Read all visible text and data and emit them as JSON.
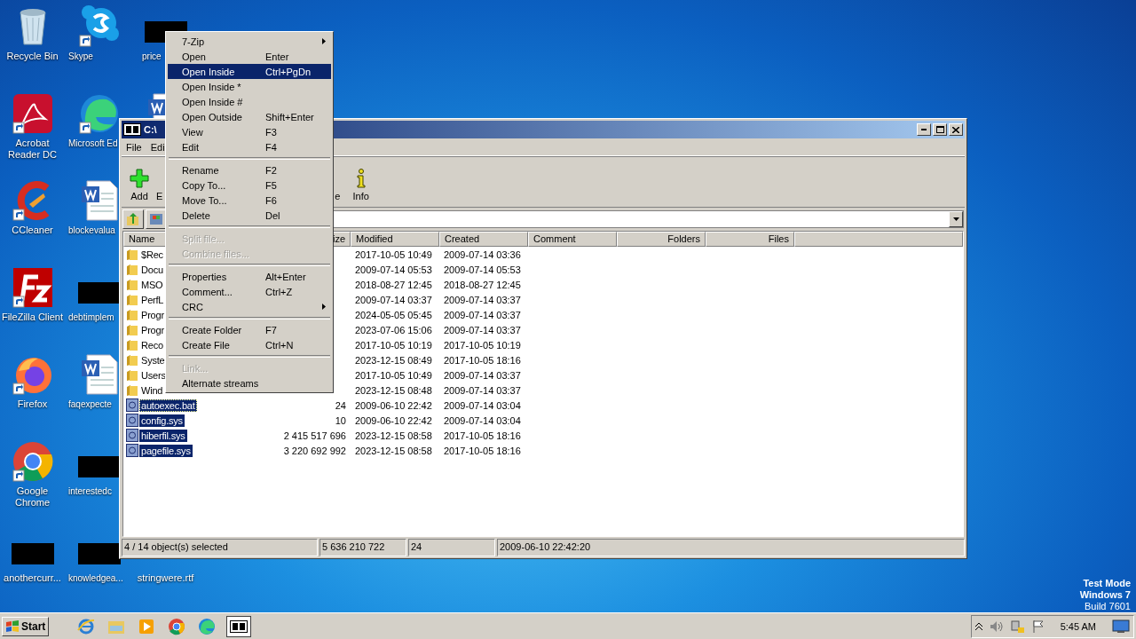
{
  "desktop": {
    "columns": [
      [
        {
          "label": "Recycle Bin",
          "kind": "recycle"
        },
        {
          "label": "Acrobat Reader DC",
          "kind": "acrobat"
        },
        {
          "label": "CCleaner",
          "kind": "ccleaner"
        },
        {
          "label": "FileZilla Client",
          "kind": "filezilla"
        },
        {
          "label": "Firefox",
          "kind": "firefox"
        },
        {
          "label": "Google Chrome",
          "kind": "chrome"
        },
        {
          "label": "anothercurr...",
          "kind": "redacted"
        }
      ],
      [
        {
          "label": "Skype",
          "kind": "skype"
        },
        {
          "label": "Microsoft Ed",
          "kind": "edge"
        },
        {
          "label": "blockevalua",
          "kind": "word"
        },
        {
          "label": "debtimplem",
          "kind": "redacted"
        },
        {
          "label": "faqexpecte",
          "kind": "word"
        },
        {
          "label": "interestedc",
          "kind": "redacted"
        },
        {
          "label": "knowledgea...",
          "kind": "redacted"
        }
      ],
      [
        {
          "label": "price",
          "kind": "redacted"
        },
        {
          "kind": "word"
        },
        {
          "label": "stringwere.rtf",
          "kind": "hidden"
        }
      ]
    ],
    "system_text": [
      "Test Mode",
      "Windows 7",
      "Build 7601"
    ]
  },
  "window": {
    "title": "C:\\",
    "menu": [
      "File",
      "Edi"
    ],
    "toolbar": [
      {
        "label": "Add",
        "kind": "add"
      },
      {
        "label": "E",
        "kind": "plain"
      },
      {
        "label": "e",
        "kind": "plain"
      },
      {
        "label": "Info",
        "kind": "info"
      }
    ],
    "columns": [
      "Name",
      "ize",
      "Modified",
      "Created",
      "Comment",
      "Folders",
      "Files"
    ],
    "rows": [
      {
        "name": "$Rec",
        "size": "",
        "modified": "2017-10-05 10:49",
        "created": "2009-07-14 03:36",
        "kind": "folder",
        "selected": false,
        "focused": false
      },
      {
        "name": "Docu",
        "size": "",
        "modified": "2009-07-14 05:53",
        "created": "2009-07-14 05:53",
        "kind": "folder",
        "selected": false,
        "focused": false
      },
      {
        "name": "MSO",
        "size": "",
        "modified": "2018-08-27 12:45",
        "created": "2018-08-27 12:45",
        "kind": "folder",
        "selected": false,
        "focused": false
      },
      {
        "name": "PerfL",
        "size": "",
        "modified": "2009-07-14 03:37",
        "created": "2009-07-14 03:37",
        "kind": "folder",
        "selected": false,
        "focused": false
      },
      {
        "name": "Progr",
        "size": "",
        "modified": "2024-05-05 05:45",
        "created": "2009-07-14 03:37",
        "kind": "folder",
        "selected": false,
        "focused": false
      },
      {
        "name": "Progr",
        "size": "",
        "modified": "2023-07-06 15:06",
        "created": "2009-07-14 03:37",
        "kind": "folder",
        "selected": false,
        "focused": false
      },
      {
        "name": "Reco",
        "size": "",
        "modified": "2017-10-05 10:19",
        "created": "2017-10-05 10:19",
        "kind": "folder",
        "selected": false,
        "focused": false
      },
      {
        "name": "Syste",
        "size": "",
        "modified": "2023-12-15 08:49",
        "created": "2017-10-05 18:16",
        "kind": "folder",
        "selected": false,
        "focused": false
      },
      {
        "name": "Users",
        "size": "",
        "modified": "2017-10-05 10:49",
        "created": "2009-07-14 03:37",
        "kind": "folder",
        "selected": false,
        "focused": false
      },
      {
        "name": "Wind",
        "size": "",
        "modified": "2023-12-15 08:48",
        "created": "2009-07-14 03:37",
        "kind": "folder",
        "selected": false,
        "focused": false
      },
      {
        "name": "autoexec.bat",
        "size": "24",
        "modified": "2009-06-10 22:42",
        "created": "2009-07-14 03:04",
        "kind": "file",
        "selected": true,
        "focused": true
      },
      {
        "name": "config.sys",
        "size": "10",
        "modified": "2009-06-10 22:42",
        "created": "2009-07-14 03:04",
        "kind": "file",
        "selected": true,
        "focused": false
      },
      {
        "name": "hiberfil.sys",
        "size": "2 415 517 696",
        "modified": "2023-12-15 08:58",
        "created": "2017-10-05 18:16",
        "kind": "file",
        "selected": true,
        "focused": false
      },
      {
        "name": "pagefile.sys",
        "size": "3 220 692 992",
        "modified": "2023-12-15 08:58",
        "created": "2017-10-05 18:16",
        "kind": "file",
        "selected": true,
        "focused": false
      }
    ],
    "status": [
      "4 / 14 object(s) selected",
      "5 636 210 722",
      "24",
      "2009-06-10 22:42:20"
    ]
  },
  "context_menu": [
    {
      "kind": "item",
      "label": "7-Zip",
      "submenu": true,
      "selected": false,
      "disabled": false
    },
    {
      "kind": "item",
      "label": "Open",
      "shortcut": "Enter",
      "submenu": false,
      "selected": false,
      "disabled": false
    },
    {
      "kind": "item",
      "label": "Open Inside",
      "shortcut": "Ctrl+PgDn",
      "submenu": false,
      "selected": true,
      "disabled": false
    },
    {
      "kind": "item",
      "label": "Open Inside *",
      "submenu": false,
      "selected": false,
      "disabled": false
    },
    {
      "kind": "item",
      "label": "Open Inside #",
      "submenu": false,
      "selected": false,
      "disabled": false
    },
    {
      "kind": "item",
      "label": "Open Outside",
      "shortcut": "Shift+Enter",
      "submenu": false,
      "selected": false,
      "disabled": false
    },
    {
      "kind": "item",
      "label": "View",
      "shortcut": "F3",
      "submenu": false,
      "selected": false,
      "disabled": false
    },
    {
      "kind": "item",
      "label": "Edit",
      "shortcut": "F4",
      "submenu": false,
      "selected": false,
      "disabled": false
    },
    {
      "kind": "separator"
    },
    {
      "kind": "item",
      "label": "Rename",
      "shortcut": "F2",
      "submenu": false,
      "selected": false,
      "disabled": false
    },
    {
      "kind": "item",
      "label": "Copy To...",
      "shortcut": "F5",
      "submenu": false,
      "selected": false,
      "disabled": false
    },
    {
      "kind": "item",
      "label": "Move To...",
      "shortcut": "F6",
      "submenu": false,
      "selected": false,
      "disabled": false
    },
    {
      "kind": "item",
      "label": "Delete",
      "shortcut": "Del",
      "submenu": false,
      "selected": false,
      "disabled": false
    },
    {
      "kind": "separator"
    },
    {
      "kind": "item",
      "label": "Split file...",
      "submenu": false,
      "selected": false,
      "disabled": true
    },
    {
      "kind": "item",
      "label": "Combine files...",
      "submenu": false,
      "selected": false,
      "disabled": true
    },
    {
      "kind": "separator"
    },
    {
      "kind": "item",
      "label": "Properties",
      "shortcut": "Alt+Enter",
      "submenu": false,
      "selected": false,
      "disabled": false
    },
    {
      "kind": "item",
      "label": "Comment...",
      "shortcut": "Ctrl+Z",
      "submenu": false,
      "selected": false,
      "disabled": false
    },
    {
      "kind": "item",
      "label": "CRC",
      "submenu": true,
      "selected": false,
      "disabled": false
    },
    {
      "kind": "separator"
    },
    {
      "kind": "item",
      "label": "Create Folder",
      "shortcut": "F7",
      "submenu": false,
      "selected": false,
      "disabled": false
    },
    {
      "kind": "item",
      "label": "Create File",
      "shortcut": "Ctrl+N",
      "submenu": false,
      "selected": false,
      "disabled": false
    },
    {
      "kind": "separator"
    },
    {
      "kind": "item",
      "label": "Link...",
      "submenu": false,
      "selected": false,
      "disabled": true
    },
    {
      "kind": "item",
      "label": "Alternate streams",
      "submenu": false,
      "selected": false,
      "disabled": false
    }
  ],
  "taskbar": {
    "start": "Start",
    "apps": [
      {
        "kind": "ie",
        "active": false
      },
      {
        "kind": "explorer",
        "active": false
      },
      {
        "kind": "media",
        "active": false
      },
      {
        "kind": "chrome",
        "active": false
      },
      {
        "kind": "edge",
        "active": false
      },
      {
        "kind": "sevenzip",
        "active": true
      }
    ],
    "clock": "5:45 AM"
  }
}
